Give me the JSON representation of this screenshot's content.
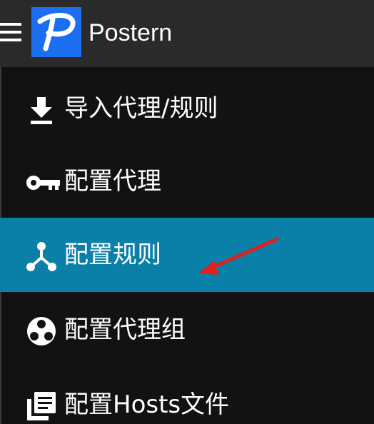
{
  "app": {
    "title": "Postern",
    "logo_letter": "P",
    "accent": "#0a7fa8",
    "logo_bg": "#1b6ef0",
    "annotation_color": "#e02020"
  },
  "menu": {
    "items": [
      {
        "label": "导入代理/规则",
        "icon": "download-icon",
        "active": false
      },
      {
        "label": "配置代理",
        "icon": "key-icon",
        "active": false
      },
      {
        "label": "配置规则",
        "icon": "rules-tree-icon",
        "active": true
      },
      {
        "label": "配置代理组",
        "icon": "proxy-group-icon",
        "active": false
      },
      {
        "label": "配置Hosts文件",
        "icon": "hosts-file-icon",
        "active": false
      }
    ]
  }
}
